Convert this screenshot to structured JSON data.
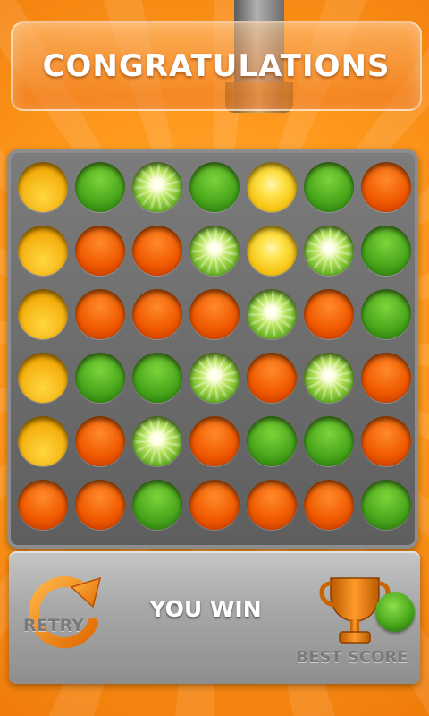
{
  "header": {
    "title": "CONGRATULATIONS"
  },
  "board": {
    "rows": 6,
    "cols": 7,
    "grid": [
      [
        "yellow",
        "green",
        "green-glow",
        "green",
        "yellow-glow",
        "green",
        "orange"
      ],
      [
        "yellow",
        "orange",
        "orange",
        "green-glow",
        "yellow-glow",
        "green-glow",
        "green"
      ],
      [
        "yellow",
        "orange",
        "orange",
        "orange",
        "green-glow",
        "orange",
        "green"
      ],
      [
        "yellow",
        "green",
        "green",
        "green-glow",
        "orange",
        "green-glow",
        "orange"
      ],
      [
        "yellow",
        "orange",
        "green-glow",
        "orange",
        "green",
        "green",
        "orange"
      ],
      [
        "orange",
        "orange",
        "green",
        "orange",
        "orange",
        "orange",
        "green"
      ]
    ]
  },
  "footer": {
    "retry_label": "RETRY",
    "status_text": "YOU WIN",
    "best_score_label": "BEST SCORE",
    "retry_icon": "retry-arrow-icon",
    "trophy_icon": "trophy-icon"
  },
  "colors": {
    "orange": "#f05a00",
    "green": "#4aa81c",
    "yellow": "#f2a600",
    "background": "#ff9a1f"
  }
}
